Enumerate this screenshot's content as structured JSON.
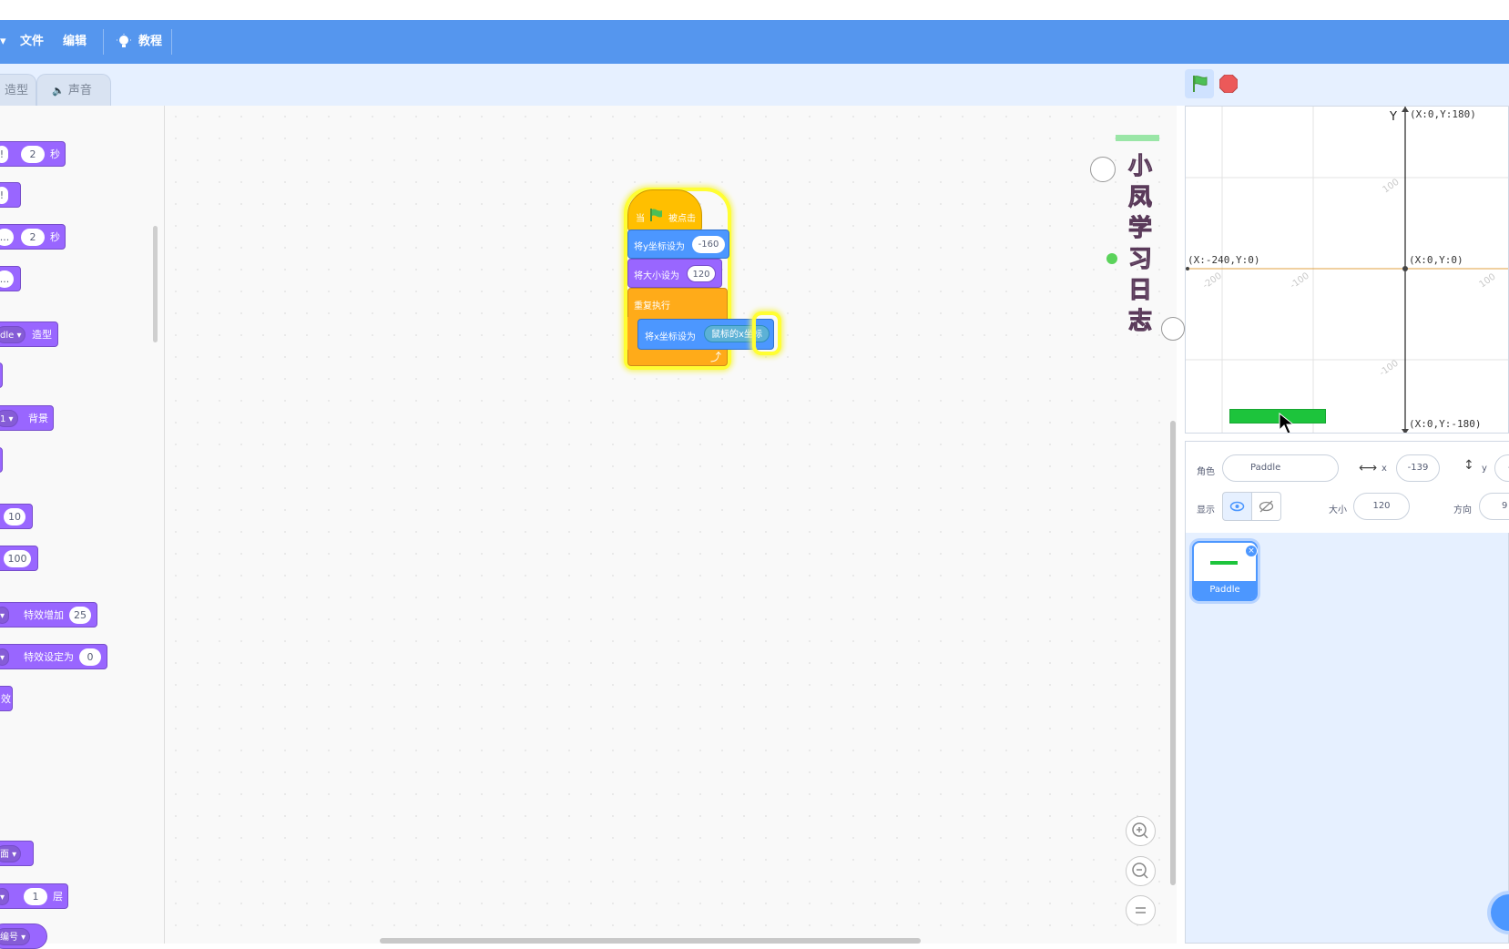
{
  "menu": {
    "file": "文件",
    "edit": "编辑",
    "tutorials": "教程"
  },
  "tabs": {
    "costumes": "造型",
    "sounds": "声音"
  },
  "palette": {
    "b1_val": "2",
    "b1_unit": "秒",
    "b3_val": "2",
    "b3_unit": "秒",
    "b5_dd": "dle",
    "b5_label": "造型",
    "b7_dd": "1",
    "b7_label": "背景",
    "b9_val": "10",
    "b10_val": "100",
    "b11_label": "特效增加",
    "b11_val": "25",
    "b12_label": "特效设定为",
    "b12_val": "0",
    "b13_label": "效",
    "b14_dd": "面",
    "b15_val": "1",
    "b15_unit": "层",
    "b16_dd": "编号",
    "frag_bang": "!",
    "frag_dots": "..."
  },
  "script": {
    "hat": {
      "pre": "当",
      "post": "被点击"
    },
    "set_y": {
      "label": "将y坐标设为",
      "value": "-160"
    },
    "set_size": {
      "label": "将大小设为",
      "value": "120"
    },
    "forever": {
      "label": "重复执行"
    },
    "set_x": {
      "label": "将x坐标设为",
      "reporter": "鼠标的x坐标"
    }
  },
  "watermark": {
    "chars": [
      "小",
      "凤",
      "学",
      "习",
      "日",
      "志"
    ]
  },
  "stage": {
    "y_axis_label": "Y",
    "coords": {
      "top": "(X:0,Y:180)",
      "left": "(X:-240,Y:0)",
      "center": "(X:0,Y:0)",
      "bottom": "(X:0,Y:-180)"
    },
    "ticks": {
      "t100": "100",
      "tm200": "-200",
      "tm100": "-100",
      "t100b": "100",
      "tm100b": "-100"
    }
  },
  "sprite_info": {
    "sprite_label": "角色",
    "sprite_name": "Paddle",
    "x_label": "x",
    "x_value": "-139",
    "y_label": "y",
    "y_value": "-",
    "show_label": "显示",
    "size_label": "大小",
    "size_value": "120",
    "direction_label": "方向",
    "direction_value": "9"
  },
  "sprites": [
    {
      "name": "Paddle",
      "selected": true
    }
  ],
  "colors": {
    "menu": "#5596ee",
    "looks": "#9966ff",
    "motion": "#4c97ff",
    "control": "#ffab19",
    "events": "#ffbf00",
    "sensing": "#5cb1d6",
    "paddle": "#1dc43c"
  }
}
